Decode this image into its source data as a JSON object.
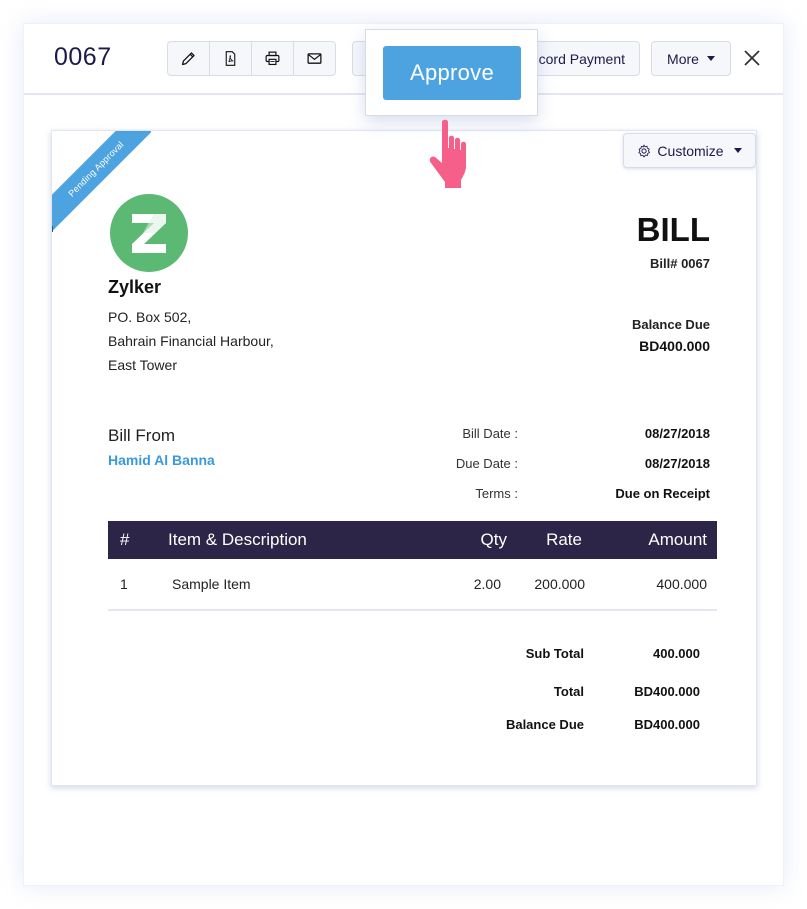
{
  "header": {
    "doc_number": "0067",
    "toolbar_icons": [
      "pencil-icon",
      "pdf-icon",
      "printer-icon",
      "mail-icon"
    ],
    "record_payment_label": "Record Payment",
    "record_payment_visible_text": "cord Payment",
    "more_label": "More",
    "close_icon": "close-icon"
  },
  "popover": {
    "approve_label": "Approve"
  },
  "cursor": {
    "icon": "hand-pointer-icon",
    "color": "#f55f8a"
  },
  "bill": {
    "status_ribbon": "Pending Approval",
    "customize_label": "Customize",
    "logo_letter": "Z",
    "company": {
      "name": "Zylker",
      "address": [
        "PO. Box 502,",
        "Bahrain Financial Harbour,",
        "East Tower"
      ]
    },
    "title": "BILL",
    "bill_number": "Bill# 0067",
    "balance_due_label": "Balance Due",
    "balance_due_value": "BD400.000",
    "bill_from_label": "Bill From",
    "vendor_name": "Hamid Al Banna",
    "meta": [
      {
        "label": "Bill Date :",
        "value": "08/27/2018"
      },
      {
        "label": "Due Date :",
        "value": "08/27/2018"
      },
      {
        "label": "Terms :",
        "value": "Due on Receipt"
      }
    ],
    "table": {
      "headers": [
        "#",
        "Item & Description",
        "Qty",
        "Rate",
        "Amount"
      ],
      "rows": [
        {
          "num": "1",
          "description": "Sample Item",
          "qty": "2.00",
          "rate": "200.000",
          "amount": "400.000"
        }
      ]
    },
    "totals": [
      {
        "label": "Sub Total",
        "value": "400.000"
      },
      {
        "label": "Total",
        "value": "BD400.000"
      },
      {
        "label": "Balance Due",
        "value": "BD400.000"
      }
    ]
  },
  "colors": {
    "accent": "#4da3e0",
    "table_header": "#2c2547",
    "logo": "#5cb974",
    "vendor_link": "#3a9ad9",
    "doc_number": "#1d1a4a"
  }
}
